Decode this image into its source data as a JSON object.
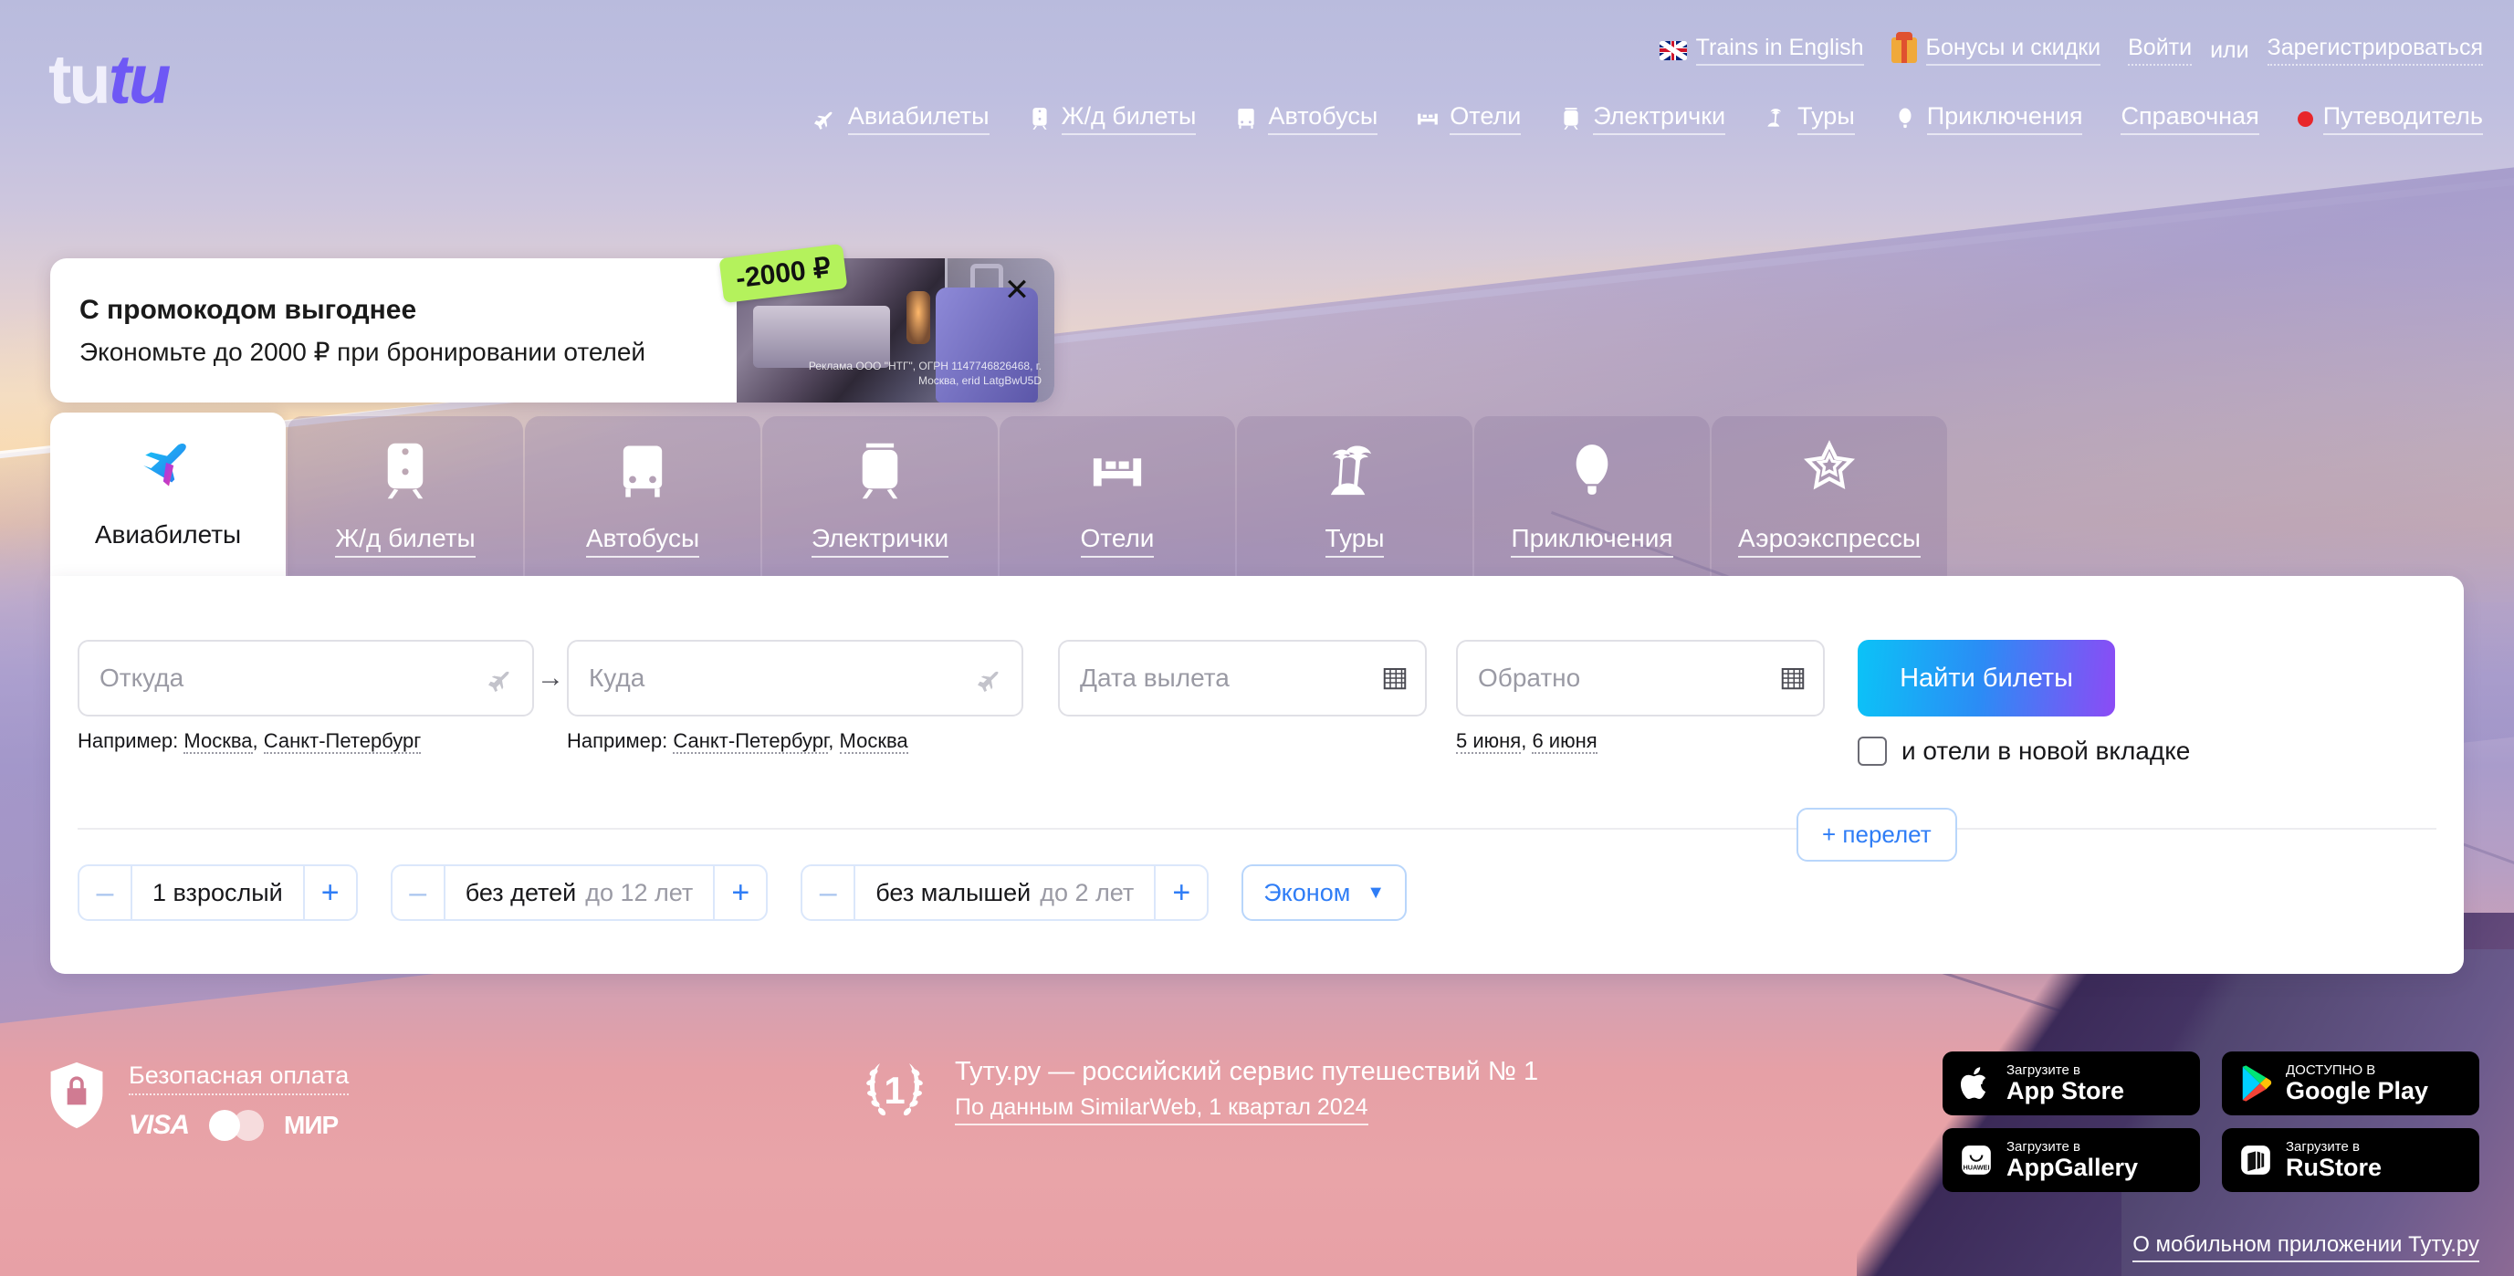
{
  "brand": {
    "logo_part1": "tu",
    "logo_part2": "tu"
  },
  "topbar": {
    "trains_en": {
      "label": "Trains in English",
      "icon": "uk-flag-icon"
    },
    "bonuses": {
      "label": "Бонусы и скидки",
      "icon": "gift-icon"
    },
    "login": "Войти",
    "or": "или",
    "register": "Зарегистрироваться"
  },
  "nav": [
    {
      "label": "Авиабилеты",
      "icon": "plane-icon"
    },
    {
      "label": "Ж/д билеты",
      "icon": "train-icon"
    },
    {
      "label": "Автобусы",
      "icon": "bus-icon"
    },
    {
      "label": "Отели",
      "icon": "bed-icon"
    },
    {
      "label": "Электрички",
      "icon": "suburban-train-icon"
    },
    {
      "label": "Туры",
      "icon": "palm-icon"
    },
    {
      "label": "Приключения",
      "icon": "balloon-icon"
    },
    {
      "label": "Справочная",
      "icon": "none"
    },
    {
      "label": "Путеводитель",
      "icon": "red-dot-icon"
    }
  ],
  "promo": {
    "title": "С промокодом выгоднее",
    "subtitle": "Экономьте до 2000 ₽ при бронировании отелей",
    "badge": "-2000 ₽",
    "disclaimer": "Реклама ООО \"НТГ\", ОГРН 1147746826468, г. Москва, erid LatgBwU5D",
    "close": "✕"
  },
  "tabs": [
    {
      "label": "Авиабилеты",
      "icon": "plane-icon",
      "active": true
    },
    {
      "label": "Ж/д билеты",
      "icon": "train-icon",
      "active": false
    },
    {
      "label": "Автобусы",
      "icon": "bus-icon",
      "active": false
    },
    {
      "label": "Электрички",
      "icon": "suburban-train-icon",
      "active": false
    },
    {
      "label": "Отели",
      "icon": "bed-icon",
      "active": false
    },
    {
      "label": "Туры",
      "icon": "palm-icon",
      "active": false
    },
    {
      "label": "Приключения",
      "icon": "balloon-icon",
      "active": false
    },
    {
      "label": "Аэроэкспрессы",
      "icon": "aeroexpress-icon",
      "active": false
    }
  ],
  "search": {
    "from": {
      "placeholder": "Откуда",
      "value": "",
      "icon": "plane-depart-icon"
    },
    "to": {
      "placeholder": "Куда",
      "value": "",
      "icon": "plane-arrive-icon"
    },
    "arrow": "→",
    "date_out": {
      "placeholder": "Дата вылета",
      "value": "",
      "icon": "calendar-icon"
    },
    "date_back": {
      "placeholder": "Обратно",
      "value": "",
      "icon": "calendar-icon"
    },
    "hint_from_prefix": "Например:",
    "hint_from_a": "Москва",
    "hint_from_b": "Санкт-Петербург",
    "hint_to_prefix": "Например:",
    "hint_to_a": "Санкт-Петербург",
    "hint_to_b": "Москва",
    "hint_date_a": "5 июня",
    "hint_date_b": "6 июня",
    "search_button": "Найти билеты",
    "hotels_checkbox_label": "и отели в новой вкладке",
    "hotels_checked": false,
    "add_flight": "+ перелет",
    "accent_gradient": [
      "#0bc3f7",
      "#2b8cf5",
      "#8c4bf5"
    ]
  },
  "passengers": {
    "adults": {
      "minus": "–",
      "plus": "+",
      "value": "1 взрослый"
    },
    "children": {
      "minus": "–",
      "plus": "+",
      "value": "без детей",
      "note": "до 12 лет"
    },
    "infants": {
      "minus": "–",
      "plus": "+",
      "value": "без малышей",
      "note": "до 2 лет"
    },
    "cabin": {
      "value": "Эконом",
      "caret": "▼"
    }
  },
  "footer": {
    "secure_payment": "Безопасная оплата",
    "pay_logos": [
      "VISA",
      "mastercard",
      "МИР"
    ],
    "rank_number": "1",
    "rank_line1": "Туту.ру — российский сервис путешествий № 1",
    "rank_line2": "По данным SimilarWeb, 1 квартал 2024",
    "stores": [
      {
        "small": "Загрузите в",
        "big": "App Store",
        "icon": "apple-icon"
      },
      {
        "small": "ДОСТУПНО В",
        "big": "Google Play",
        "icon": "google-play-icon"
      },
      {
        "small": "Загрузите в",
        "big": "AppGallery",
        "icon": "huawei-icon"
      },
      {
        "small": "Загрузите в",
        "big": "RuStore",
        "icon": "rustore-icon"
      }
    ],
    "mobile_link": "О мобильном приложении Туту.ру"
  }
}
